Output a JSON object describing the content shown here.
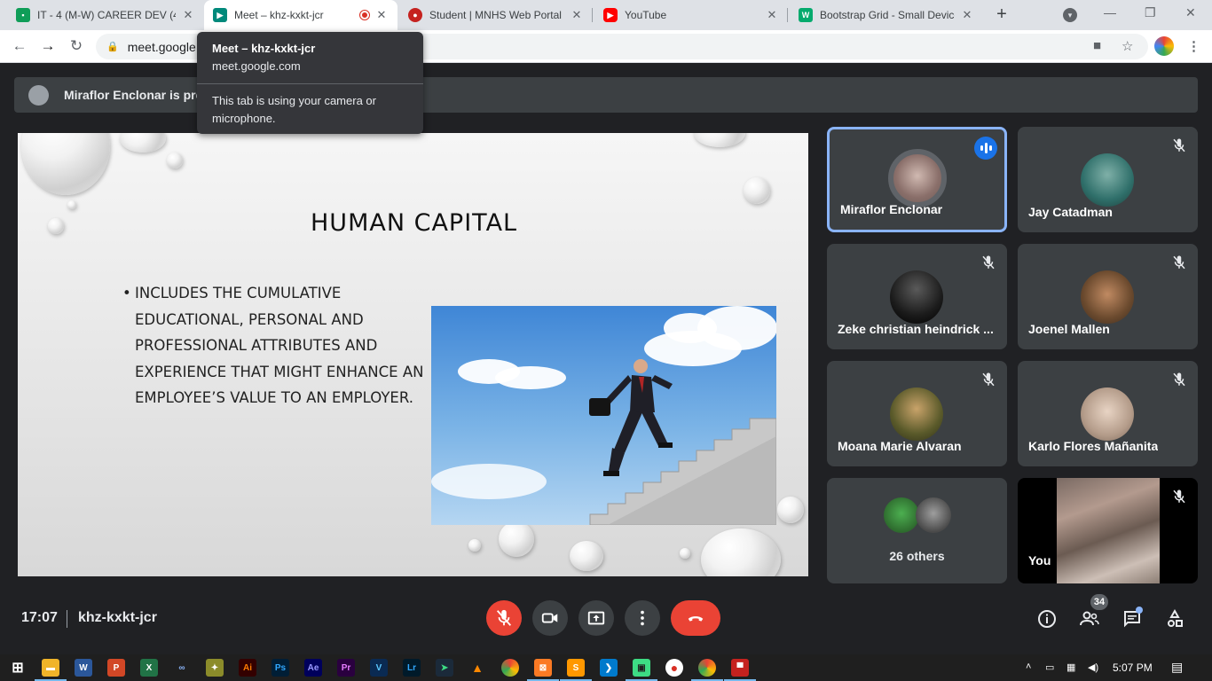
{
  "browser": {
    "tabs": [
      {
        "title": "IT - 4 (M-W) CAREER DEV (4(",
        "icon": "classroom-icon",
        "color": "#0f9d58"
      },
      {
        "title": "Meet – khz-kxkt-jcr",
        "icon": "meet-icon",
        "color": "#00897b"
      },
      {
        "title": "Student | MNHS Web Portal",
        "icon": "school-seal-icon",
        "color": "#c5221f"
      },
      {
        "title": "YouTube",
        "icon": "youtube-icon",
        "color": "#ff0000"
      },
      {
        "title": "Bootstrap Grid - Small Device",
        "icon": "w3schools-icon",
        "color": "#04aa6d"
      }
    ],
    "url": "meet.google",
    "hover_card": {
      "title": "Meet – khz-kxkt-jcr",
      "domain": "meet.google.com",
      "note": "This tab is using your camera or microphone."
    }
  },
  "banner": {
    "text": "Miraflor Enclonar is pre"
  },
  "slide": {
    "title": "HUMAN CAPITAL",
    "bullet_marker": "•",
    "bullet_lines": [
      "INCLUDES THE CUMULATIVE",
      "EDUCATIONAL, PERSONAL AND",
      "PROFESSIONAL ATTRIBUTES AND",
      "EXPERIENCE THAT MIGHT ENHANCE AN",
      "EMPLOYEE’S VALUE TO AN EMPLOYER."
    ]
  },
  "participants": [
    {
      "name": "Miraflor Enclonar",
      "speaking": true,
      "avatar_color": "#8a6f6a"
    },
    {
      "name": "Jay Catadman",
      "muted": true,
      "avatar_color": "#2f6f6a"
    },
    {
      "name": "Zeke christian heindrick ...",
      "muted": true,
      "avatar_color": "#1b1b1b"
    },
    {
      "name": "Joenel Mallen",
      "muted": true,
      "avatar_color": "#6b4a2e"
    },
    {
      "name": "Moana Marie Alvaran",
      "muted": true,
      "avatar_color": "#5a5a2a"
    },
    {
      "name": "Karlo Flores Mañanita",
      "muted": true,
      "avatar_color": "#b49c8a"
    },
    {
      "others_label": "26 others"
    },
    {
      "name": "You",
      "muted": true
    }
  ],
  "meeting": {
    "time": "17:07",
    "code": "khz-kxkt-jcr",
    "people_count": "34"
  },
  "taskbar": {
    "clock": "5:07 PM"
  }
}
